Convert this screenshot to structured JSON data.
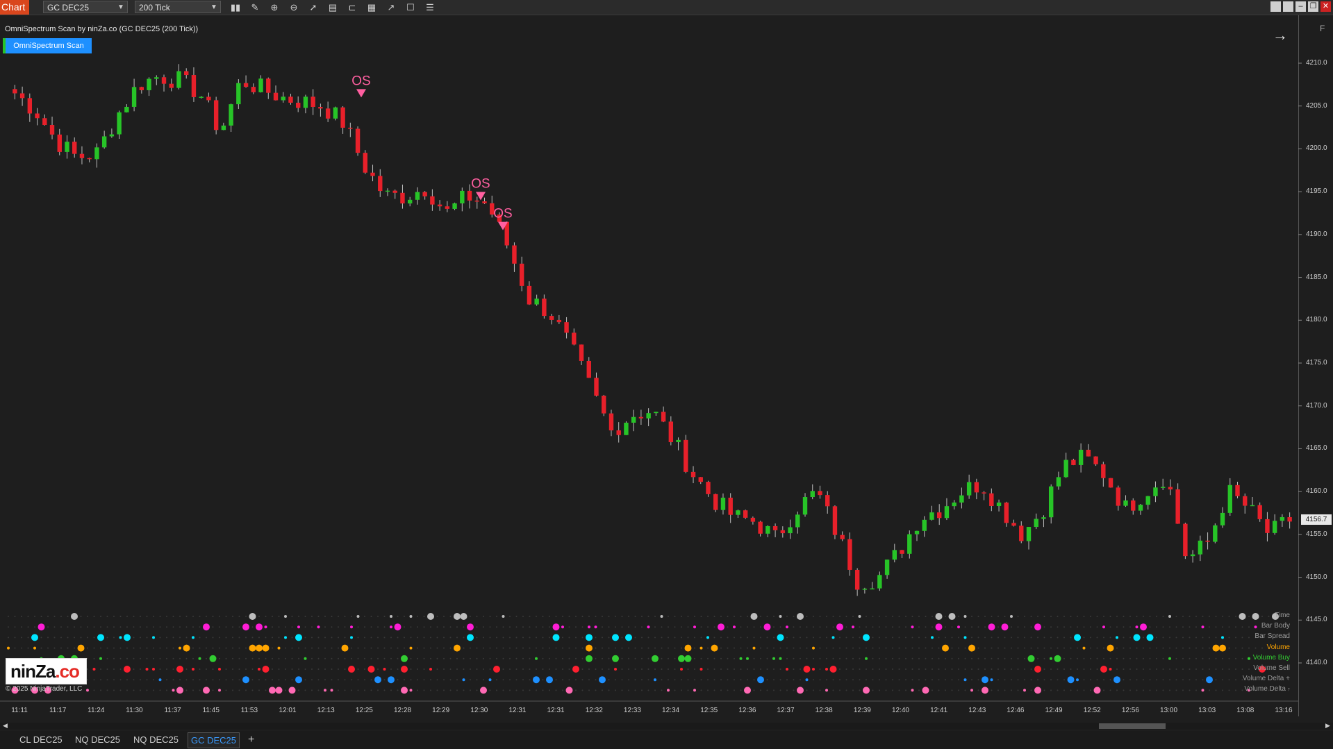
{
  "toolbar": {
    "chart_tab": "Chart",
    "instrument": "GC DEC25",
    "interval": "200 Tick"
  },
  "indicator": {
    "title": "OmniSpectrum Scan by ninZa.co (GC DEC25 (200 Tick))",
    "button": "OmniSpectrum Scan",
    "signal_label": "OS"
  },
  "price_axis": {
    "labels": [
      "4210.0",
      "4205.0",
      "4200.0",
      "4195.0",
      "4190.0",
      "4185.0",
      "4180.0",
      "4175.0",
      "4170.0",
      "4165.0",
      "4160.0",
      "4155.0",
      "4150.0",
      "4145.0",
      "4140.0"
    ],
    "current_price": "4156.7",
    "corner_label": "F"
  },
  "time_axis": {
    "labels": [
      "11:11",
      "11:17",
      "11:24",
      "11:30",
      "11:37",
      "11:45",
      "11:53",
      "12:01",
      "12:13",
      "12:25",
      "12:28",
      "12:29",
      "12:30",
      "12:31",
      "12:31",
      "12:32",
      "12:33",
      "12:34",
      "12:35",
      "12:36",
      "12:37",
      "12:38",
      "12:39",
      "12:40",
      "12:41",
      "12:43",
      "12:46",
      "12:49",
      "12:52",
      "12:56",
      "13:00",
      "13:03",
      "13:08",
      "13:16"
    ]
  },
  "scan_rows": [
    {
      "label": "Time",
      "color": "#bdbdbd"
    },
    {
      "label": "Bar Body",
      "color": "#ff1dd6"
    },
    {
      "label": "Bar Spread",
      "color": "#00e5ff"
    },
    {
      "label": "Volume",
      "color": "#ffa500"
    },
    {
      "label": "Volume Buy",
      "color": "#32cd32"
    },
    {
      "label": "Volume Sell",
      "color": "#ff2030"
    },
    {
      "label": "Volume Delta +",
      "color": "#1e90ff"
    },
    {
      "label": "Volume Delta -",
      "color": "#ff69b4"
    }
  ],
  "colors": {
    "up": "#27c427",
    "down": "#e8202a",
    "signal": "#ff5fa0"
  },
  "logo": {
    "text_main": "ninZa",
    "text_dot": ".co"
  },
  "copyright": "© 2025 NinjaTrader, LLC",
  "bottom_tabs": [
    "CL DEC25",
    "NQ DEC25",
    "NQ DEC25",
    "GC DEC25"
  ],
  "chart_data": {
    "type": "candlestick",
    "instrument": "GC DEC25",
    "interval": "200 Tick",
    "y_range": [
      4138.0,
      4214.0
    ],
    "close_path": [
      4206.5,
      4204.5,
      4201.0,
      4199.0,
      4199.5,
      4204.0,
      4207.5,
      4208.5,
      4208.0,
      4206.5,
      4202.0,
      4208.0,
      4207.0,
      4206.0,
      4205.5,
      4205.0,
      4203.0,
      4198.0,
      4194.5,
      4194.5,
      4195.5,
      4192.5,
      4194.5,
      4193.5,
      4188.5,
      4182.5,
      4181.0,
      4177.0,
      4172.0,
      4167.0,
      4169.0,
      4169.5,
      4166.0,
      4162.0,
      4159.0,
      4157.0,
      4156.5,
      4154.5,
      4158.0,
      4160.0,
      4155.0,
      4149.5,
      4150.0,
      4153.0,
      4157.0,
      4158.0,
      4160.0,
      4161.0,
      4158.0,
      4155.0,
      4158.0,
      4163.0,
      4164.0,
      4162.0,
      4158.0,
      4160.0,
      4162.0,
      4152.0,
      4154.0,
      4160.0,
      4158.0,
      4155.0,
      4156.7
    ],
    "signals": [
      {
        "label": "OS",
        "price": 4206.0
      },
      {
        "label": "OS",
        "price": 4194.0
      },
      {
        "label": "OS",
        "price": 4190.5
      }
    ]
  }
}
